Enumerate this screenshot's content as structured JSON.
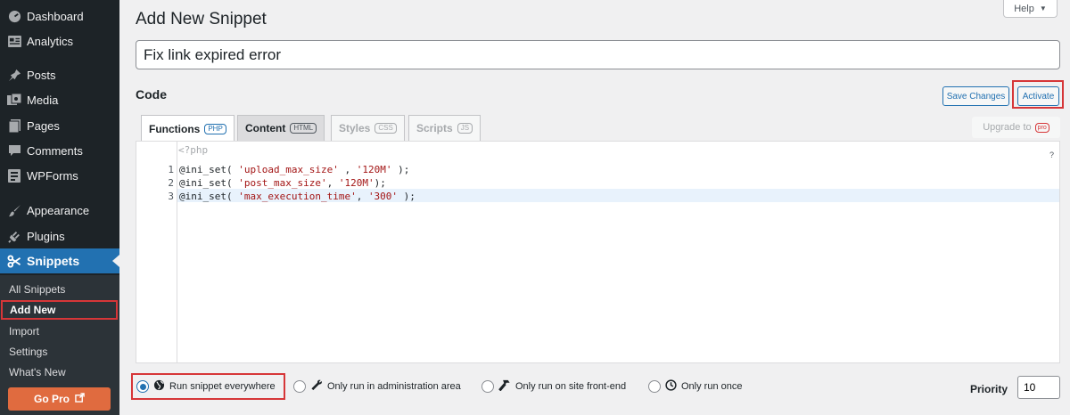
{
  "sidebar": {
    "items": [
      {
        "label": "Dashboard",
        "icon": "dashboard-icon"
      },
      {
        "label": "Analytics",
        "icon": "analytics-icon"
      },
      {
        "label": "Posts",
        "icon": "pin-icon"
      },
      {
        "label": "Media",
        "icon": "media-icon"
      },
      {
        "label": "Pages",
        "icon": "pages-icon"
      },
      {
        "label": "Comments",
        "icon": "comment-icon"
      },
      {
        "label": "WPForms",
        "icon": "forms-icon"
      },
      {
        "label": "Appearance",
        "icon": "brush-icon"
      },
      {
        "label": "Plugins",
        "icon": "plug-icon"
      },
      {
        "label": "Snippets",
        "icon": "scissors-icon"
      }
    ],
    "submenu": [
      "All Snippets",
      "Add New",
      "Import",
      "Settings",
      "What's New"
    ],
    "go_pro": "Go Pro"
  },
  "help": "Help",
  "page_title": "Add New Snippet",
  "snippet_title": "Fix link expired error",
  "code_label": "Code",
  "buttons": {
    "save": "Save Changes",
    "activate": "Activate"
  },
  "tabs": [
    {
      "label": "Functions",
      "tag": "PHP"
    },
    {
      "label": "Content",
      "tag": "HTML"
    },
    {
      "label": "Styles",
      "tag": "CSS"
    },
    {
      "label": "Scripts",
      "tag": "JS"
    }
  ],
  "upgrade": {
    "label": "Upgrade to",
    "badge": "pro"
  },
  "editor": {
    "php_open": "<?php",
    "help_mark": "?",
    "line_numbers": [
      "1",
      "2",
      "3"
    ]
  },
  "scopes": [
    {
      "label": "Run snippet everywhere",
      "icon": "globe-icon",
      "selected": true
    },
    {
      "label": "Only run in administration area",
      "icon": "wrench-icon",
      "selected": false
    },
    {
      "label": "Only run on site front-end",
      "icon": "hammer-icon",
      "selected": false
    },
    {
      "label": "Only run once",
      "icon": "clock-icon",
      "selected": false
    }
  ],
  "priority": {
    "label": "Priority",
    "value": "10"
  },
  "colors": {
    "accent": "#2271b1",
    "sidebar": "#1d2327",
    "highlight": "#d63638",
    "go_pro": "#e06b3f"
  }
}
